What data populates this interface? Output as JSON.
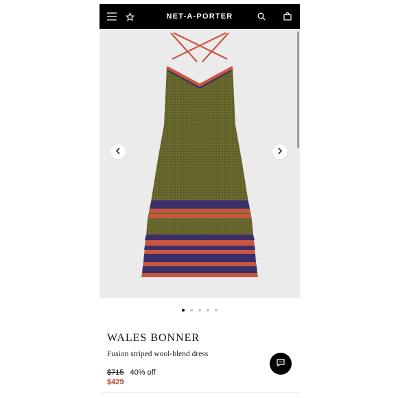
{
  "header": {
    "brand": "NET-A-PORTER",
    "icons": [
      "menu-icon",
      "star-icon",
      "search-icon",
      "shopping-bag-icon"
    ]
  },
  "gallery": {
    "prev_icon": "chevron-left-icon",
    "next_icon": "chevron-right-icon",
    "dots": 5,
    "active_dot": 1
  },
  "product": {
    "designer": "WALES BONNER",
    "name": "Fusion striped wool-blend dress",
    "original_price": "$715",
    "discount": "40% off",
    "sale_price": "$429"
  },
  "chat": {
    "icon": "chat-icon"
  },
  "colors": {
    "header_bg": "#000000",
    "sale_price": "#b73a2e",
    "dress_body": "#6b6a2e",
    "stripe_red": "#c9573f",
    "stripe_navy": "#3b2f6b"
  }
}
